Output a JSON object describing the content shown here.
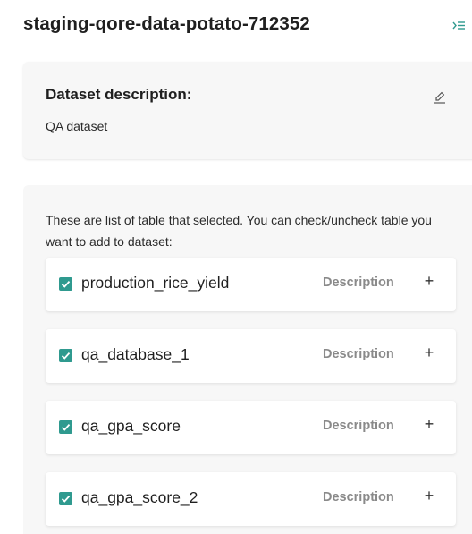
{
  "header": {
    "title": "staging-qore-data-potato-712352",
    "collapse_icon": "sidebar-collapse-icon"
  },
  "description_card": {
    "title": "Dataset description:",
    "text": "QA dataset",
    "edit_icon": "pencil-icon"
  },
  "tables_panel": {
    "instructions": "These are list of table that selected. You can check/uncheck table you want to add to dataset:",
    "accent_color": "#2f9a8f",
    "items": [
      {
        "name": "production_rice_yield",
        "checked": true,
        "description_label": "Description",
        "add_label": "+"
      },
      {
        "name": "qa_database_1",
        "checked": true,
        "description_label": "Description",
        "add_label": "+"
      },
      {
        "name": "qa_gpa_score",
        "checked": true,
        "description_label": "Description",
        "add_label": "+"
      },
      {
        "name": "qa_gpa_score_2",
        "checked": true,
        "description_label": "Description",
        "add_label": "+"
      }
    ]
  }
}
